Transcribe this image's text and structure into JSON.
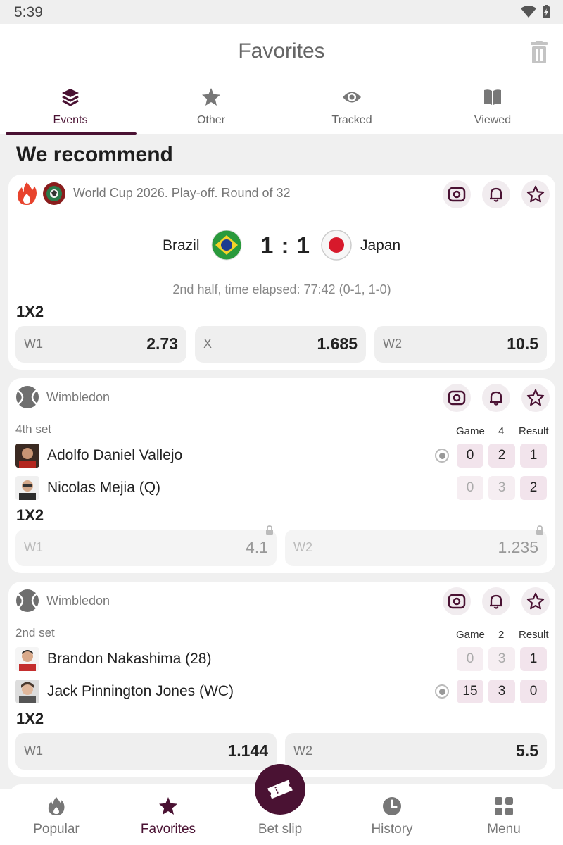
{
  "status_bar": {
    "time": "5:39"
  },
  "header": {
    "title": "Favorites"
  },
  "tabs": [
    {
      "label": "Events",
      "icon": "layers-icon",
      "active": true
    },
    {
      "label": "Other",
      "icon": "star-icon",
      "active": false
    },
    {
      "label": "Tracked",
      "icon": "eye-icon",
      "active": false
    },
    {
      "label": "Viewed",
      "icon": "book-icon",
      "active": false
    }
  ],
  "section_title": "We recommend",
  "events": [
    {
      "league": "World Cup 2026. Play-off. Round of 32",
      "home": "Brazil",
      "away": "Japan",
      "score": "1 : 1",
      "status": "2nd half, time elapsed: 77:42 (0-1, 1-0)",
      "market": "1X2",
      "odds": [
        {
          "label": "W1",
          "value": "2.73"
        },
        {
          "label": "X",
          "value": "1.685"
        },
        {
          "label": "W2",
          "value": "10.5"
        }
      ]
    },
    {
      "league": "Wimbledon",
      "set_label": "4th set",
      "headers": {
        "game": "Game",
        "set": "4",
        "result": "Result"
      },
      "players": [
        {
          "name": "Adolfo Daniel Vallejo",
          "game": "0",
          "set": "2",
          "result": "1",
          "serving": true
        },
        {
          "name": "Nicolas Mejia (Q)",
          "game": "0",
          "set": "3",
          "result": "2",
          "serving": false
        }
      ],
      "market": "1X2",
      "odds": [
        {
          "label": "W1",
          "value": "4.1",
          "locked": true
        },
        {
          "label": "W2",
          "value": "1.235",
          "locked": true
        }
      ]
    },
    {
      "league": "Wimbledon",
      "set_label": "2nd set",
      "headers": {
        "game": "Game",
        "set": "2",
        "result": "Result"
      },
      "players": [
        {
          "name": "Brandon Nakashima (28)",
          "game": "0",
          "set": "3",
          "result": "1",
          "serving": false
        },
        {
          "name": "Jack Pinnington Jones (WC)",
          "game": "15",
          "set": "3",
          "result": "0",
          "serving": true
        }
      ],
      "market": "1X2",
      "odds": [
        {
          "label": "W1",
          "value": "1.144",
          "locked": false
        },
        {
          "label": "W2",
          "value": "5.5",
          "locked": false
        }
      ]
    }
  ],
  "bottom_nav": [
    {
      "label": "Popular",
      "icon": "flame-icon",
      "active": false
    },
    {
      "label": "Favorites",
      "icon": "star-icon",
      "active": true
    },
    {
      "label": "Bet slip",
      "icon": "ticket-icon",
      "active": false
    },
    {
      "label": "History",
      "icon": "clock-icon",
      "active": false
    },
    {
      "label": "Menu",
      "icon": "grid-icon",
      "active": false
    }
  ],
  "colors": {
    "accent": "#4a1233",
    "chip": "#f2e4ec",
    "background": "#f0f0f0"
  }
}
